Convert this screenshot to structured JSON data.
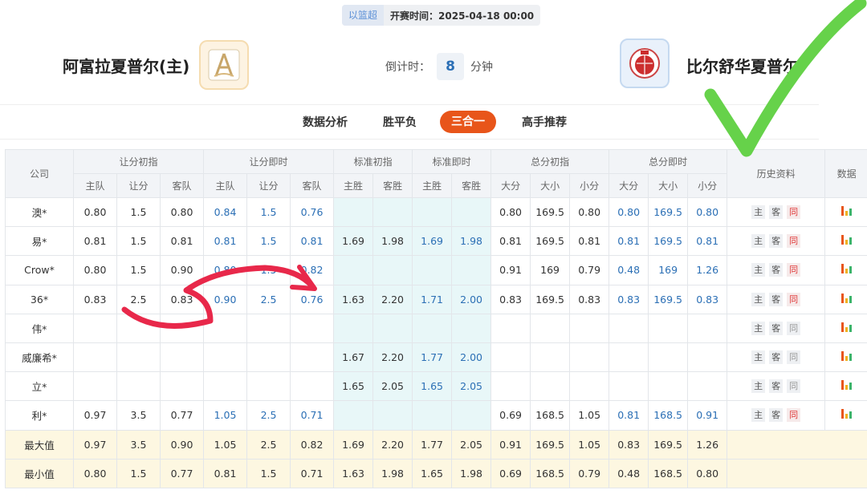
{
  "header": {
    "tag_label": "以篮超",
    "start_time": "开赛时间：2025-04-18 00:00",
    "home_team": "阿富拉夏普尔(主)",
    "away_team": "比尔舒华夏普尔",
    "countdown_prefix": "倒计时：",
    "countdown_value": "8",
    "countdown_unit": "分钟"
  },
  "tabs": [
    "数据分析",
    "胜平负",
    "三合一",
    "高手推荐"
  ],
  "active_tab": "三合一",
  "table": {
    "company_header": "公司",
    "groups": [
      "让分初指",
      "让分即时",
      "标准初指",
      "标准即时",
      "总分初指",
      "总分即时"
    ],
    "history_header": "历史资料",
    "data_header": "数据",
    "subheaders": [
      "主队",
      "让分",
      "客队",
      "主队",
      "让分",
      "客队",
      "主胜",
      "客胜",
      "主胜",
      "客胜",
      "大分",
      "大小",
      "小分",
      "大分",
      "大小",
      "小分"
    ],
    "history_labels": [
      "主",
      "客",
      "同"
    ],
    "rows": [
      {
        "company": "澳*",
        "cells": [
          "0.80",
          "1.5",
          "0.80",
          "0.84",
          "1.5",
          "0.76",
          "",
          "",
          "",
          "",
          "0.80",
          "169.5",
          "0.80",
          "0.80",
          "169.5",
          "0.80"
        ],
        "same_red": true
      },
      {
        "company": "易*",
        "cells": [
          "0.81",
          "1.5",
          "0.81",
          "0.81",
          "1.5",
          "0.81",
          "1.69",
          "1.98",
          "1.69",
          "1.98",
          "0.81",
          "169.5",
          "0.81",
          "0.81",
          "169.5",
          "0.81"
        ],
        "same_red": true
      },
      {
        "company": "Crow*",
        "cells": [
          "0.80",
          "1.5",
          "0.90",
          "0.80",
          "1.5",
          "0.82",
          "",
          "",
          "",
          "",
          "0.91",
          "169",
          "0.79",
          "0.48",
          "169",
          "1.26"
        ],
        "same_red": true
      },
      {
        "company": "36*",
        "cells": [
          "0.83",
          "2.5",
          "0.83",
          "0.90",
          "2.5",
          "0.76",
          "1.63",
          "2.20",
          "1.71",
          "2.00",
          "0.83",
          "169.5",
          "0.83",
          "0.83",
          "169.5",
          "0.83"
        ],
        "same_red": true
      },
      {
        "company": "伟*",
        "cells": [
          "",
          "",
          "",
          "",
          "",
          "",
          "",
          "",
          "",
          "",
          "",
          "",
          "",
          "",
          "",
          ""
        ],
        "same_red": false
      },
      {
        "company": "威廉希*",
        "cells": [
          "",
          "",
          "",
          "",
          "",
          "",
          "1.67",
          "2.20",
          "1.77",
          "2.00",
          "",
          "",
          "",
          "",
          "",
          ""
        ],
        "same_red": false
      },
      {
        "company": "立*",
        "cells": [
          "",
          "",
          "",
          "",
          "",
          "",
          "1.65",
          "2.05",
          "1.65",
          "2.05",
          "",
          "",
          "",
          "",
          "",
          ""
        ],
        "same_red": false
      },
      {
        "company": "利*",
        "cells": [
          "0.97",
          "3.5",
          "0.77",
          "1.05",
          "2.5",
          "0.71",
          "",
          "",
          "",
          "",
          "0.69",
          "168.5",
          "1.05",
          "0.81",
          "168.5",
          "0.91"
        ],
        "same_red": true
      }
    ],
    "summary": [
      {
        "label": "最大值",
        "cells": [
          "0.97",
          "3.5",
          "0.90",
          "1.05",
          "2.5",
          "0.82",
          "1.69",
          "2.20",
          "1.77",
          "2.05",
          "0.91",
          "169.5",
          "1.05",
          "0.83",
          "169.5",
          "1.26"
        ]
      },
      {
        "label": "最小值",
        "cells": [
          "0.80",
          "1.5",
          "0.77",
          "0.81",
          "1.5",
          "0.71",
          "1.63",
          "1.98",
          "1.65",
          "1.98",
          "0.69",
          "168.5",
          "0.79",
          "0.48",
          "168.5",
          "0.80"
        ]
      }
    ]
  },
  "colors": {
    "accent": "#e8551a",
    "live_value": "#2b6fb5",
    "teal_column": "#e8f7f8",
    "summary_row": "#fdf7e1",
    "annotation_red": "#e8284a",
    "annotation_green": "#66d24a"
  },
  "icons": {
    "data_icon": "bar-chart-icon",
    "home_logo": "home-team-crest-icon",
    "away_logo": "away-team-crest-icon"
  }
}
